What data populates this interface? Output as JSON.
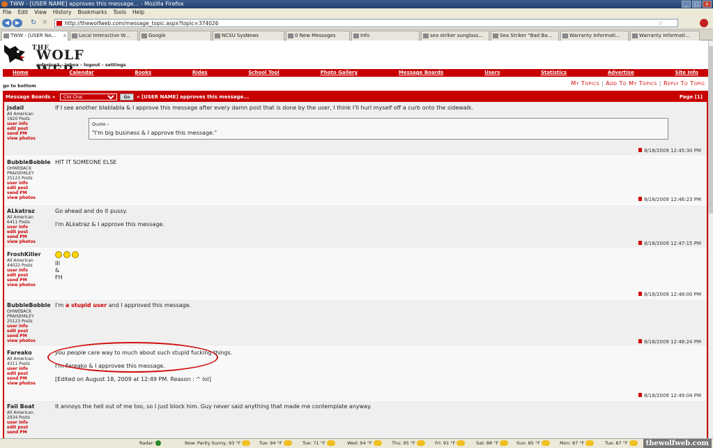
{
  "window": {
    "title": "TWW - [USER NAME] approves this message... - Mozilla Firefox"
  },
  "menu": [
    "File",
    "Edit",
    "View",
    "History",
    "Bookmarks",
    "Tools",
    "Help"
  ],
  "url": "http://thewolfweb.com/message_topic.aspx?topic=374026",
  "tabs": [
    {
      "label": "TWW - [USER NA..."
    },
    {
      "label": "Local Interactive W..."
    },
    {
      "label": "Google"
    },
    {
      "label": "NCSU SysNews"
    },
    {
      "label": "0 New Messages"
    },
    {
      "label": "Info"
    },
    {
      "label": "sea striker sunglass..."
    },
    {
      "label": "Sea Striker \"Bad Ba..."
    },
    {
      "label": "Warranty Informati..."
    },
    {
      "label": "Warranty Informati..."
    }
  ],
  "site": {
    "logo_the": "THE",
    "logo_ww": "WOLF WEB",
    "userlinks": "wdprice3 - inbox - logout - settings",
    "nav": [
      "Home",
      "Calendar",
      "Books",
      "Rides",
      "School Tool",
      "Photo Gallery",
      "Message Boards",
      "Users",
      "Statistics",
      "Advertise",
      "Site Info"
    ],
    "go_bottom": "go to bottom",
    "my_topics": "My Topics",
    "add_topics": "Add To My Topics",
    "reply": "Reply To Topic"
  },
  "board": {
    "breadcrumb": "Message Boards »",
    "select": "Chit Chat",
    "go": "Go",
    "topic": "» [USER NAME] approves this message...",
    "page": "Page [1]"
  },
  "posts": [
    {
      "author": "jsdail",
      "rank": "All American",
      "posts": "1920 Posts",
      "text": "If I see another blablabla & I approve this message after every damn post that is done by the user, I think I'll hurl myself off a curb onto the sidewalk.",
      "quote_label": "Quote ›",
      "quote": "\"I'm big business & I approve this message.\"",
      "date": "8/18/2009 12:45:30 PM"
    },
    {
      "author": "BubbleBobble",
      "rank": "OHWEBACK",
      "rank2": "PRAISEMILEY",
      "posts": "25123 Posts",
      "text": "HIT IT SOMEONE ELSE",
      "date": "8/18/2009 12:46:23 PM"
    },
    {
      "author": "ALkatraz",
      "rank": "All American",
      "posts": "6411 Posts",
      "text": "Go ahead and do it pussy.",
      "text2": "I'm ALkatraz & I approve this message.",
      "date": "8/18/2009 12:47:15 PM"
    },
    {
      "author": "FroshKiller",
      "rank": "All American",
      "posts": "44022 Posts",
      "l1": "III",
      "l2": "&",
      "l3": "FH",
      "date": "8/18/2009 12:48:00 PM"
    },
    {
      "author": "BubbleBobble",
      "rank": "OHWEBACK",
      "rank2": "PRAISEMILEY",
      "posts": "25123 Posts",
      "pre": "I'm",
      "red": "a stupid user",
      "post": "and I approved this message.",
      "date": "8/18/2009 12:48:24 PM"
    },
    {
      "author": "Fareako",
      "rank": "All American",
      "posts": "4311 Posts",
      "em": "you people",
      "text": "care way to much about such stupid fucking things.",
      "text2": "I'm Fareako & I approvee this message.",
      "text3": "[Edited on August 18, 2009 at 12:49 PM. Reason : ^ lol]",
      "date": "8/18/2009 12:49:04 PM"
    },
    {
      "author": "Fail Boat",
      "rank": "All American",
      "posts": "2934 Posts",
      "text": "It annoys the hell out of me too, so I just block him. Guy never said anything that made me contemplate anyway."
    }
  ],
  "links": {
    "info": "user info",
    "edit": "edit post",
    "pm": "send PM",
    "photos": "view photos"
  },
  "status": {
    "radar": "Radar:",
    "items": [
      "Now: Partly Sunny, 93 °F",
      "Tue: 94 °F",
      "Tue: 71 °F",
      "Wed: 94 °F",
      "Thu: 95 °F",
      "Fri: 91 °F",
      "Sat: 88 °F",
      "Sun: 85 °F",
      "Mon: 87 °F",
      "Tue: 87 °F"
    ],
    "watermark": "thewolfweb.com"
  }
}
